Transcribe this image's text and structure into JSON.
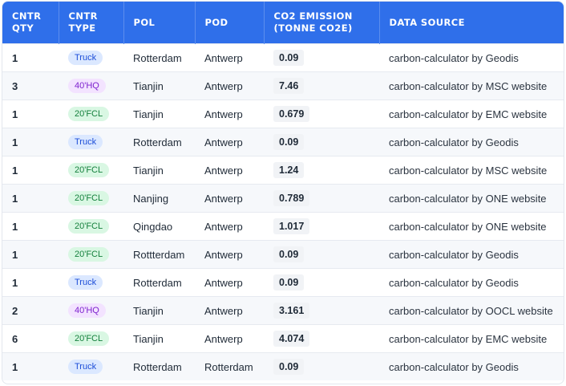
{
  "headers": [
    "CNTR QTY",
    "CNTR TYPE",
    "POL",
    "POD",
    "CO2 EMISSION (TONNE CO2E)",
    "DATA SOURCE"
  ],
  "rows": [
    {
      "qty": "1",
      "type": "Truck",
      "type_kind": "truck",
      "pol": "Rotterdam",
      "pod": "Antwerp",
      "emission": "0.09",
      "source": "carbon-calculator by Geodis"
    },
    {
      "qty": "3",
      "type": "40'HQ",
      "type_kind": "hq",
      "pol": "Tianjin",
      "pod": "Antwerp",
      "emission": "7.46",
      "source": "carbon-calculator by MSC website"
    },
    {
      "qty": "1",
      "type": "20'FCL",
      "type_kind": "fcl",
      "pol": "Tianjin",
      "pod": "Antwerp",
      "emission": "0.679",
      "source": "carbon-calculator by EMC website"
    },
    {
      "qty": "1",
      "type": "Truck",
      "type_kind": "truck",
      "pol": "Rotterdam",
      "pod": "Antwerp",
      "emission": "0.09",
      "source": "carbon-calculator by Geodis"
    },
    {
      "qty": "1",
      "type": "20'FCL",
      "type_kind": "fcl",
      "pol": "Tianjin",
      "pod": "Antwerp",
      "emission": "1.24",
      "source": "carbon-calculator by MSC website"
    },
    {
      "qty": "1",
      "type": "20'FCL",
      "type_kind": "fcl",
      "pol": "Nanjing",
      "pod": "Antwerp",
      "emission": "0.789",
      "source": "carbon-calculator by ONE website"
    },
    {
      "qty": "1",
      "type": "20'FCL",
      "type_kind": "fcl",
      "pol": "Qingdao",
      "pod": "Antwerp",
      "emission": "1.017",
      "source": "carbon-calculator by ONE website"
    },
    {
      "qty": "1",
      "type": "20'FCL",
      "type_kind": "fcl",
      "pol": "Rottterdam",
      "pod": "Antwerp",
      "emission": "0.09",
      "source": "carbon-calculator by Geodis"
    },
    {
      "qty": "1",
      "type": "Truck",
      "type_kind": "truck",
      "pol": "Rotterdam",
      "pod": "Antwerp",
      "emission": "0.09",
      "source": "carbon-calculator by Geodis"
    },
    {
      "qty": "2",
      "type": "40'HQ",
      "type_kind": "hq",
      "pol": "Tianjin",
      "pod": "Antwerp",
      "emission": "3.161",
      "source": "carbon-calculator by OOCL website"
    },
    {
      "qty": "6",
      "type": "20'FCL",
      "type_kind": "fcl",
      "pol": "Tianjin",
      "pod": "Antwerp",
      "emission": "4.074",
      "source": "carbon-calculator by EMC website"
    },
    {
      "qty": "1",
      "type": "Truck",
      "type_kind": "truck",
      "pol": "Rotterdam",
      "pod": "Rotterdam",
      "emission": "0.09",
      "source": "carbon-calculator by Geodis"
    }
  ],
  "colors": {
    "header_bg": "#2f6fea",
    "truck_badge": "#dbe8ff",
    "hq_badge": "#f3e3ff",
    "fcl_badge": "#d9f7e3"
  }
}
